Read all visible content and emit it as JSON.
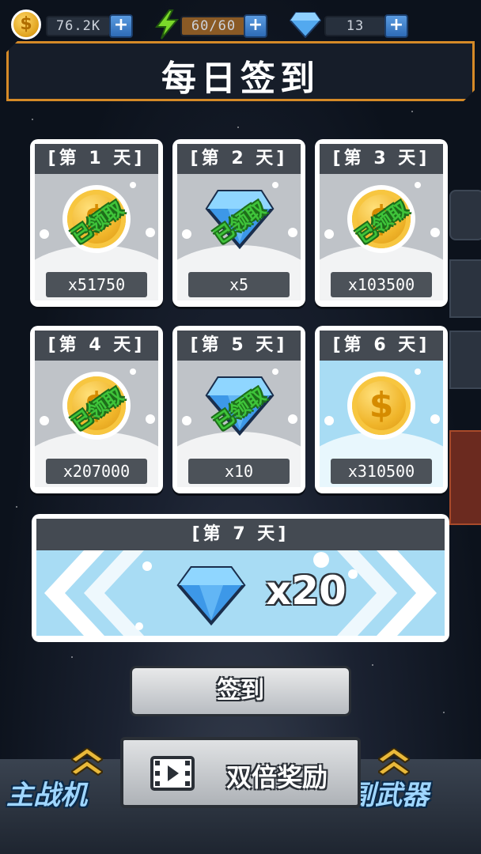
{
  "resources": {
    "coins": "76.2K",
    "energy": "60/60",
    "gems": "13",
    "coin_symbol": "$",
    "plus": "+"
  },
  "title": "每日签到",
  "days": [
    {
      "label": "[第 1 天]",
      "reward": "coin",
      "amount": "x51750",
      "claimed": true
    },
    {
      "label": "[第 2 天]",
      "reward": "gem",
      "amount": "x5",
      "claimed": true
    },
    {
      "label": "[第 3 天]",
      "reward": "coin",
      "amount": "x103500",
      "claimed": true
    },
    {
      "label": "[第 4 天]",
      "reward": "coin",
      "amount": "x207000",
      "claimed": true
    },
    {
      "label": "[第 5 天]",
      "reward": "gem",
      "amount": "x10",
      "claimed": true
    },
    {
      "label": "[第 6 天]",
      "reward": "coin",
      "amount": "x310500",
      "claimed": false
    }
  ],
  "claimed_stamp": "已领取",
  "day7": {
    "label": "[第 7 天]",
    "reward": "gem",
    "amount": "x20"
  },
  "sign_button": "签到",
  "double_button": "双倍奖励",
  "nav": {
    "left": "主战机",
    "right": "副武器"
  },
  "colors": {
    "accent_orange": "#d58a27",
    "claimed_green": "#3fc43a",
    "active_blue": "#a8dcf4"
  }
}
